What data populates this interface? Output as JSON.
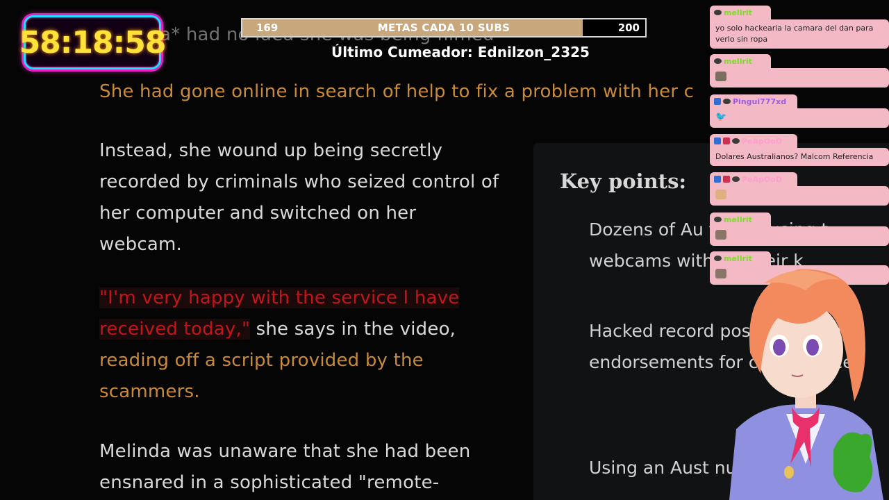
{
  "timer": {
    "value": "58:18:58"
  },
  "goal": {
    "current": "169",
    "label": "METAS CADA 10 SUBS",
    "target": "200",
    "fill_percent": 84.5
  },
  "cumeador": {
    "text": "Último Cumeador: Ednilzon_2325"
  },
  "article": {
    "line_top": "Melinda* had no idea she was being filmed",
    "line_online": "She had gone online in search of help to fix a problem with her c",
    "para_instead": "Instead, she wound up being secretly recorded by criminals who seized control of her computer and switched on her webcam.",
    "quote": "\"I'm very happy with the service I have received today,\"",
    "says": " she says in the video,",
    "reading": "reading off a script provided by the scammers.",
    "para_melinda": "Melinda was unaware that she had been ensnared in a sophisticated \"remote-",
    "keypoints_title": "Key points:",
    "kp1": "Dozens of Au filmed using t webcams without their k",
    "kp2": "Hacked record posted on Youtu endorsements for cam service",
    "kp3": "Using an Aust number, the"
  },
  "chat": {
    "messages": [
      {
        "user": "mellrit",
        "text": "yo solo hackearia la camara del dan para verlo sin ropa"
      },
      {
        "user": "mellrit",
        "text": ""
      },
      {
        "user": "Pingui777xd",
        "text": ""
      },
      {
        "user": "PeApOoD",
        "text": "Dolares Australianos? Malcom Referencia"
      },
      {
        "user": "PeApOoD",
        "text": ""
      },
      {
        "user": "mellrit",
        "text": ""
      },
      {
        "user": "mellrit",
        "text": ""
      }
    ]
  },
  "colors": {
    "timer_text": "#ffe23a",
    "timer_border": "#18e0ff",
    "chat_bg": "#f3b9c4",
    "goal_fill": "#c7a77b"
  },
  "icons": [
    "moderator-badge-icon",
    "subscriber-badge-icon",
    "cat-emote-icon",
    "bird-emote-icon",
    "hamster-emote-icon"
  ]
}
